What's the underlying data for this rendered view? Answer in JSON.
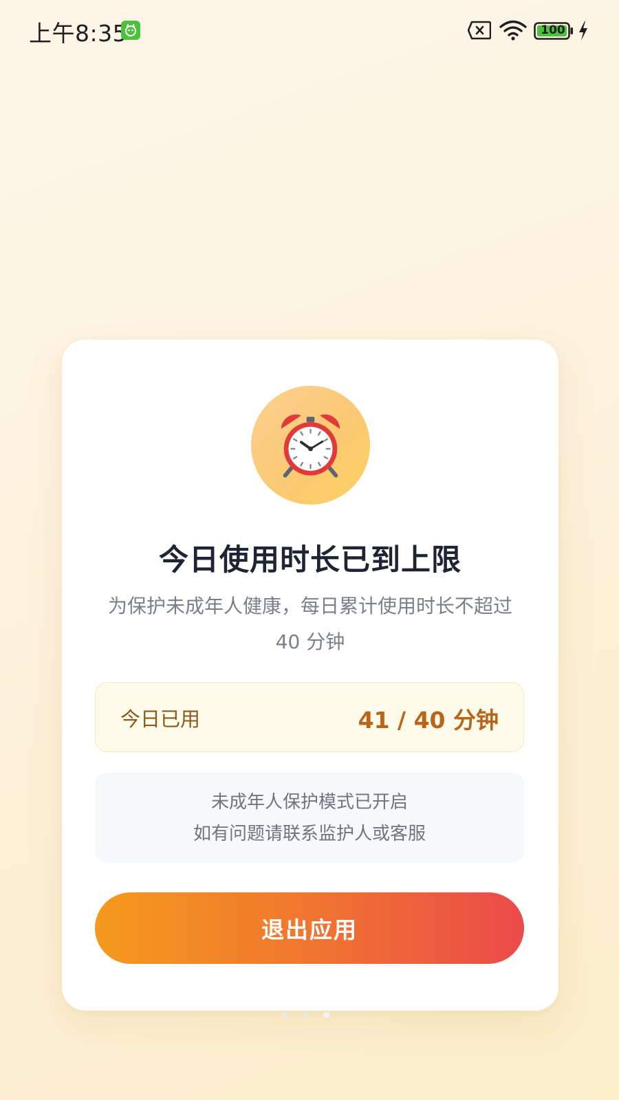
{
  "status_bar": {
    "time": "上午8:35",
    "app_notification_icon": "green-app-icon",
    "sim_icon": "no-sim-icon",
    "wifi_icon": "wifi-icon",
    "battery_level": "100",
    "battery_color": "#4cc13b",
    "charging_icon": "charging-bolt-icon"
  },
  "card": {
    "icon": "alarm-clock-icon",
    "title": "今日使用时长已到上限",
    "description": "为保护未成年人健康，每日累计使用时长不超过 40 分钟",
    "usage": {
      "label": "今日已用",
      "value": "41 / 40 分钟"
    },
    "notice": {
      "line1": "未成年人保护模式已开启",
      "line2": "如有问题请联系监护人或客服"
    },
    "exit_button_label": "退出应用"
  },
  "colors": {
    "button_gradient_start": "#f49a1d",
    "button_gradient_end": "#eb4a4a",
    "usage_value": "#b8651a",
    "title": "#1e2433"
  }
}
